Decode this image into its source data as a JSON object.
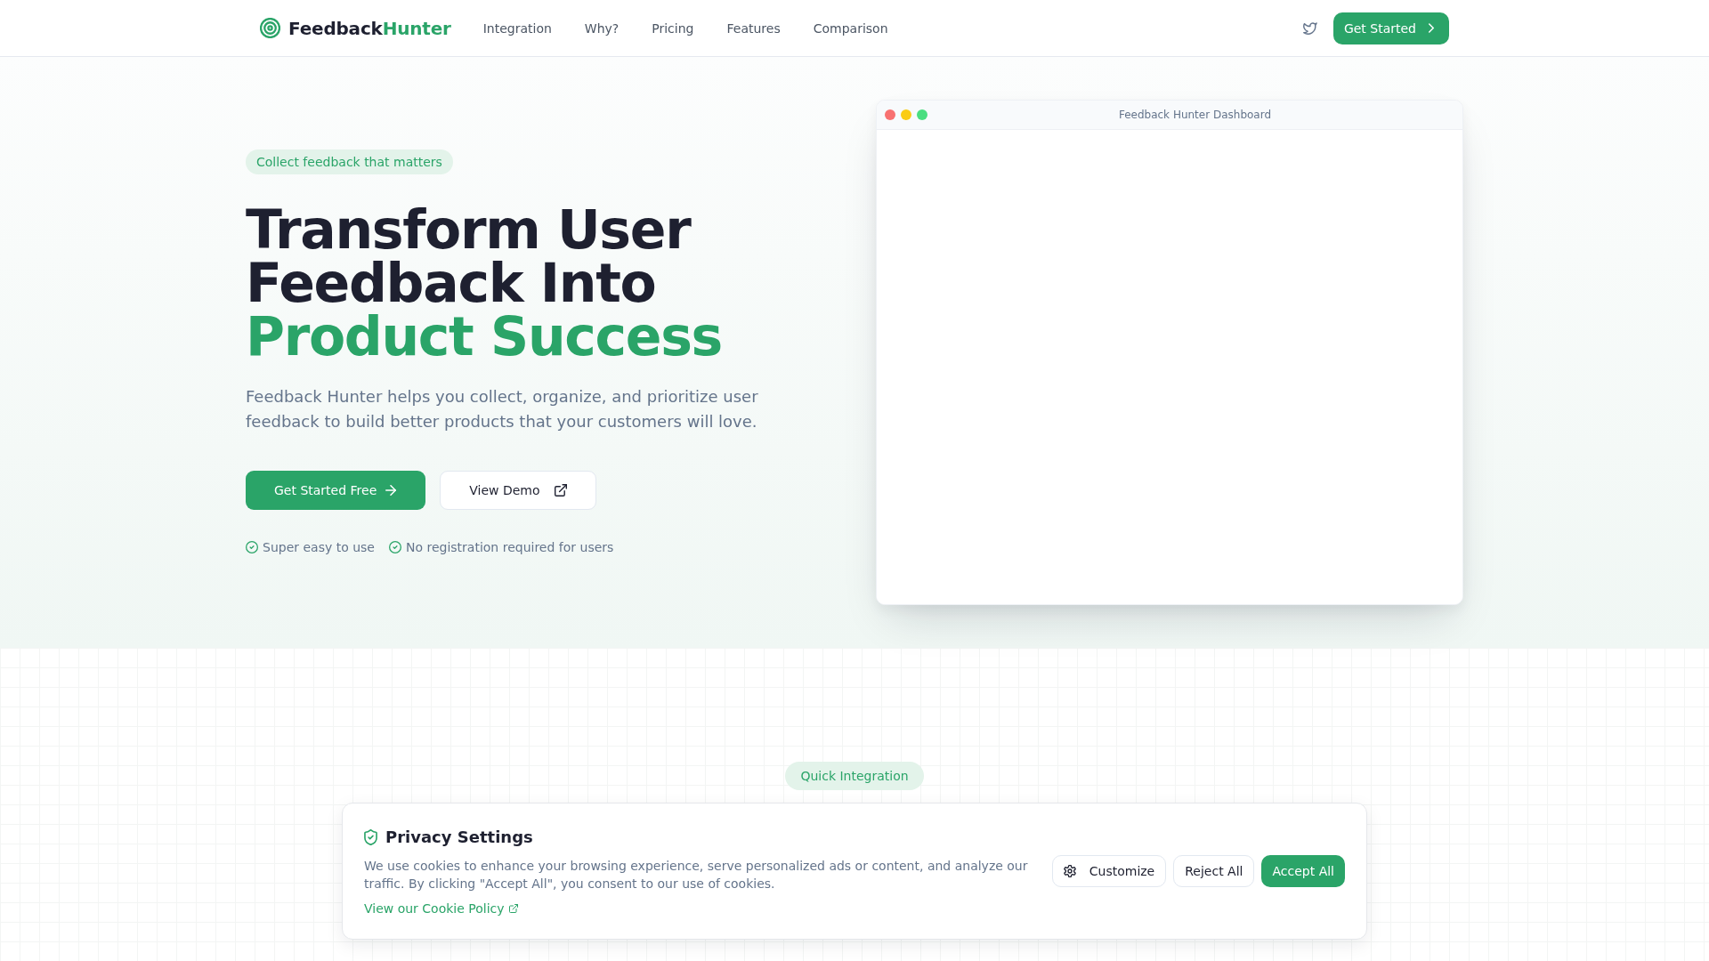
{
  "nav": {
    "logo": {
      "text": "Feedback",
      "highlight": "Hunter"
    },
    "links": [
      "Integration",
      "Why?",
      "Pricing",
      "Features",
      "Comparison"
    ],
    "cta": "Get Started"
  },
  "hero": {
    "badge": "Collect feedback that matters",
    "heading": {
      "text": "Transform User Feedback Into",
      "highlight": "Product Success"
    },
    "description": "Feedback Hunter helps you collect, organize, and prioritize user feedback to build better products that your customers will love.",
    "buttons": [
      {
        "label": "Get Started Free",
        "kind": "primary"
      },
      {
        "label": "View Demo",
        "kind": "secondary"
      }
    ],
    "perks": [
      "Super easy to use",
      "No registration required for users"
    ],
    "preview_window": {
      "title": "Feedback Hunter Dashboard"
    }
  },
  "integration": {
    "badge": "Quick Integration"
  },
  "cookie_banner": {
    "title": "Privacy Settings",
    "text": "We use cookies to enhance your browsing experience, serve personalized ads or content, and analyze our traffic. By clicking \"Accept All\", you consent to our use of cookies.",
    "link": "View our Cookie Policy",
    "buttons": [
      {
        "label": "Customize",
        "kind": "settings"
      },
      {
        "label": "Reject All",
        "kind": "outline"
      },
      {
        "label": "Accept All",
        "kind": "primary"
      }
    ]
  }
}
